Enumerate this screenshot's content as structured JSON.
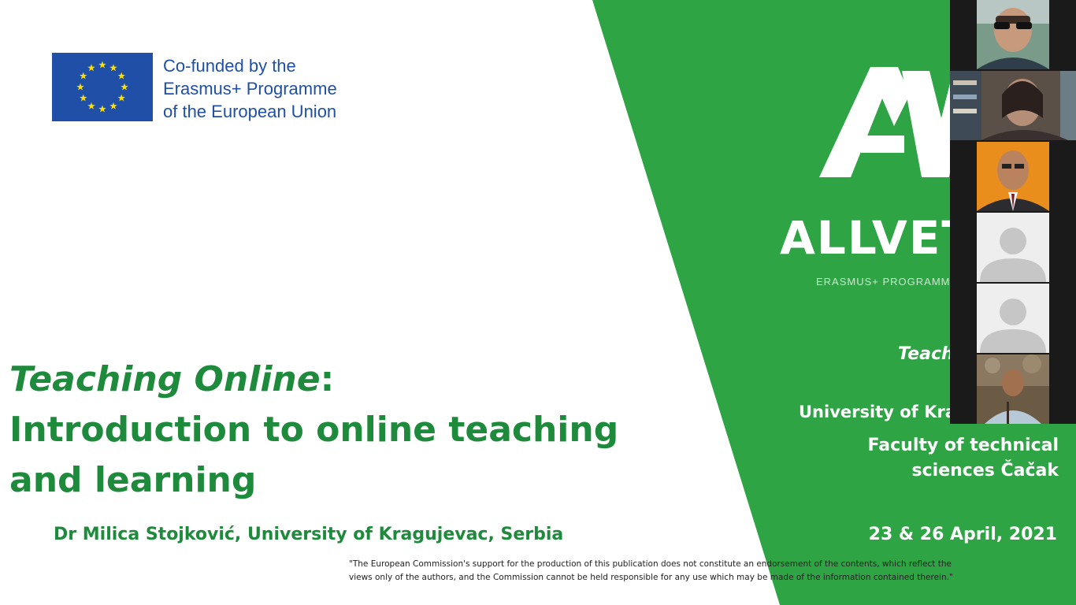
{
  "eu": {
    "line1": "Co-funded by the",
    "line2": "Erasmus+ Programme",
    "line3": "of the European Union"
  },
  "brand": {
    "name": "ALLVET",
    "sub": "ERASMUS+ PROGRAMME"
  },
  "right": {
    "teaching": "Teaching",
    "university": "University of Kragujevac",
    "faculty_line1": "Faculty of technical",
    "faculty_line2": "sciences Čačak",
    "date": "23 & 26 April, 2021"
  },
  "title": {
    "italic": "Teaching Online",
    "colon": ":",
    "line2": "Introduction to online teaching",
    "line3": "and learning"
  },
  "author": "Dr Milica Stojković, University of Kragujevac, Serbia",
  "disclaimer": {
    "line1": "\"The European Commission's support for the production of this publication does not constitute an endorsement of the contents, which reflect the",
    "line2": "views only of the authors, and the Commission cannot be held responsible for any use which may be made of the information contained therein.\""
  },
  "colors": {
    "green": "#2ea444",
    "title_green": "#1e8a3c",
    "eu_blue": "#1f4fa6",
    "eu_star": "#ffdd00"
  },
  "participants": [
    {
      "type": "video",
      "icon": "person-sunglasses"
    },
    {
      "type": "video",
      "icon": "person-glasses"
    },
    {
      "type": "video",
      "icon": "person-suit"
    },
    {
      "type": "avatar",
      "icon": "default-avatar-icon"
    },
    {
      "type": "avatar",
      "icon": "default-avatar-icon"
    },
    {
      "type": "video",
      "icon": "person-outdoor"
    }
  ]
}
